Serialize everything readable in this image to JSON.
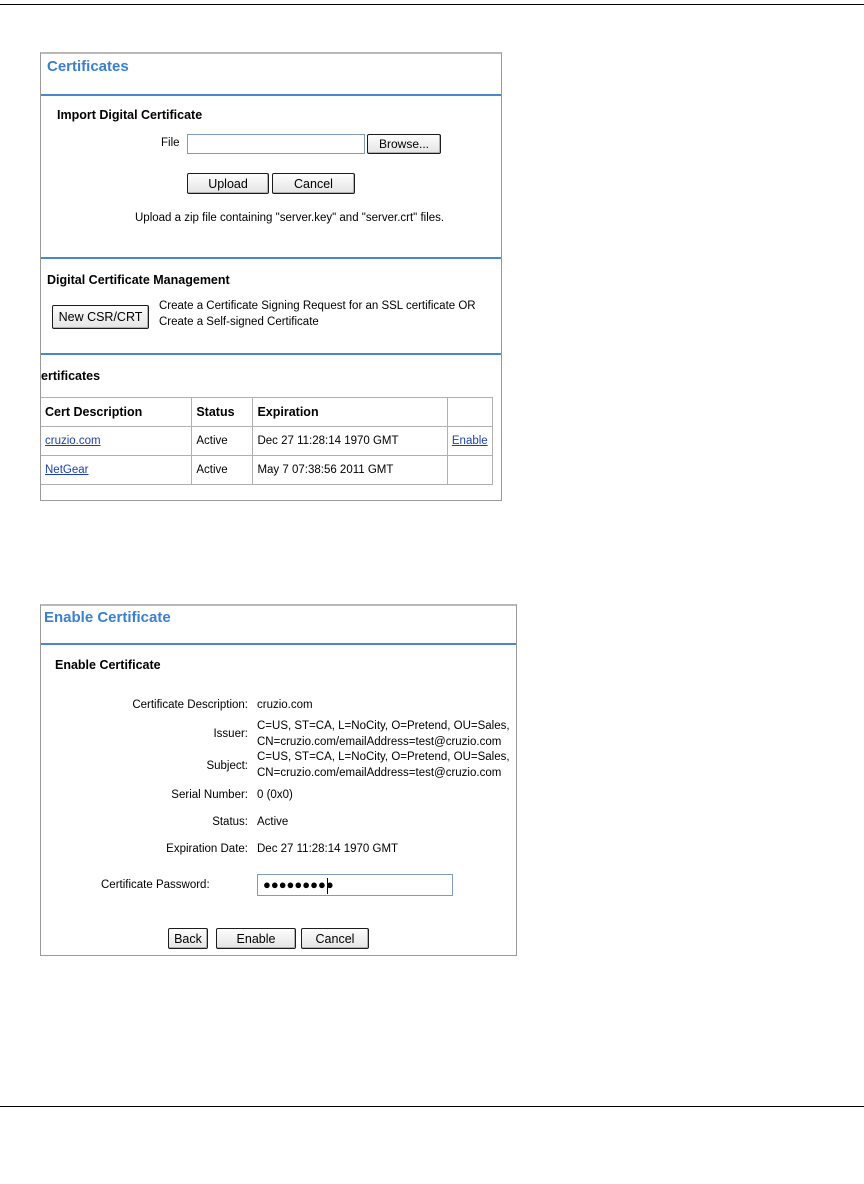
{
  "certificates_panel": {
    "title": "Certificates",
    "import": {
      "heading": "Import Digital Certificate",
      "file_label": "File",
      "file_value": "",
      "browse_label": "Browse...",
      "upload_label": "Upload",
      "cancel_label": "Cancel",
      "help_text": "Upload a zip file containing \"server.key\" and \"server.crt\" files."
    },
    "management": {
      "heading": "Digital Certificate Management",
      "new_csr_label": "New CSR/CRT",
      "desc_line1": "Create a Certificate Signing Request for an SSL certificate OR",
      "desc_line2": "Create a Self-signed Certificate"
    },
    "list": {
      "heading": "ertificates",
      "columns": [
        "Cert Description",
        "Status",
        "Expiration",
        ""
      ],
      "rows": [
        {
          "description": "cruzio.com",
          "status": "Active",
          "expiration": "Dec 27 11:28:14 1970 GMT",
          "action": "Enable"
        },
        {
          "description": "NetGear",
          "status": "Active",
          "expiration": "May 7 07:38:56 2011 GMT",
          "action": ""
        }
      ]
    }
  },
  "enable_panel": {
    "title": "Enable Certificate",
    "heading": "Enable Certificate",
    "fields": {
      "description_label": "Certificate Description:",
      "description_value": "cruzio.com",
      "issuer_label": "Issuer:",
      "issuer_line1": "C=US, ST=CA, L=NoCity, O=Pretend, OU=Sales,",
      "issuer_line2": "CN=cruzio.com/emailAddress=test@cruzio.com",
      "subject_label": "Subject:",
      "subject_line1": "C=US, ST=CA, L=NoCity, O=Pretend, OU=Sales,",
      "subject_line2": "CN=cruzio.com/emailAddress=test@cruzio.com",
      "serial_label": "Serial Number:",
      "serial_value": "0 (0x0)",
      "status_label": "Status:",
      "status_value": "Active",
      "expiration_label": "Expiration Date:",
      "expiration_value": "Dec 27 11:28:14 1970 GMT",
      "password_label": "Certificate Password:",
      "password_mask": "●●●●●●●●●"
    },
    "buttons": {
      "back": "Back",
      "enable": "Enable",
      "cancel": "Cancel"
    }
  }
}
